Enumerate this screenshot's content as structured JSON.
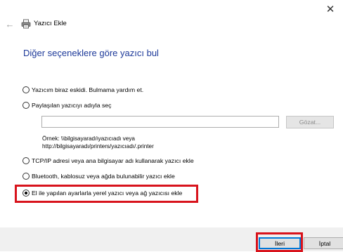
{
  "window": {
    "title": "Yazıcı Ekle",
    "close_glyph": "✕",
    "back_glyph": "←"
  },
  "heading": "Diğer seçeneklere göre yazıcı bul",
  "options": [
    {
      "label": "Yazıcım biraz eskidi. Bulmama yardım et.",
      "selected": false
    },
    {
      "label": "Paylaşılan yazıcıyı adıyla seç",
      "selected": false
    },
    {
      "label": "TCP/IP adresi veya ana bilgisayar adı kullanarak yazıcı ekle",
      "selected": false
    },
    {
      "label": "Bluetooth, kablosuz veya ağda bulunabilir yazıcı ekle",
      "selected": false
    },
    {
      "label": "El ile yapılan ayarlarla yerel yazıcı veya ağ yazıcısı ekle",
      "selected": true
    }
  ],
  "shared_printer": {
    "input_value": "",
    "browse_label": "Gözat...",
    "example_line1": "Örnek: \\\\bilgisayaradı\\yazıcıadı veya",
    "example_line2": "http://bilgisayaradı/printers/yazıcıadı/.printer"
  },
  "footer": {
    "next_label": "İleri",
    "cancel_label": "İptal"
  },
  "colors": {
    "heading": "#1e3a9a",
    "highlight": "#d8131c",
    "footer_bg": "#f0f0f0",
    "default_button_border": "#0078d7"
  },
  "icons": {
    "window_icon": "printer-icon",
    "back": "back-arrow-icon",
    "close": "close-icon"
  }
}
